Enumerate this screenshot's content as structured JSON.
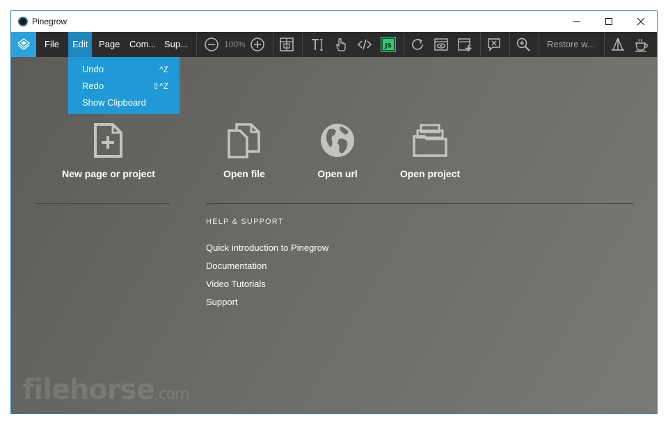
{
  "window": {
    "title": "Pinegrow",
    "controls": {
      "minimize": "minimize",
      "maximize": "maximize",
      "close": "close"
    }
  },
  "menubar": {
    "items": [
      "File",
      "Edit",
      "Page",
      "Com...",
      "Sup..."
    ],
    "active": "Edit"
  },
  "toolbar": {
    "zoom_level": "100%",
    "restore_label": "Restore w...",
    "icons": [
      "zoom-out-icon",
      "zoom-in-icon",
      "layout-frame-icon",
      "text-edit-icon",
      "hand-pointer-icon",
      "code-icon",
      "javascript-icon",
      "refresh-icon",
      "preview-eye-icon",
      "add-page-icon",
      "chat-icon",
      "search-zoom-icon",
      "tools-icon",
      "coffee-icon"
    ],
    "js_accent": "#2ecc71"
  },
  "edit_menu": {
    "items": [
      {
        "label": "Undo",
        "shortcut": "^Z"
      },
      {
        "label": "Redo",
        "shortcut": "⇧^Z"
      },
      {
        "label": "Show Clipboard",
        "shortcut": ""
      }
    ]
  },
  "actions": [
    {
      "label": "New page or project",
      "icon": "new-file-icon"
    },
    {
      "label": "Open file",
      "icon": "open-file-icon"
    },
    {
      "label": "Open url",
      "icon": "globe-icon"
    },
    {
      "label": "Open project",
      "icon": "folder-icon"
    }
  ],
  "help": {
    "heading": "HELP & SUPPORT",
    "links": [
      "Quick introduction to Pinegrow",
      "Documentation",
      "Video Tutorials",
      "Support"
    ]
  },
  "watermark": {
    "text": "filehorse",
    "suffix": ".com"
  },
  "colors": {
    "accent": "#1f9ad6",
    "toolbar_bg": "#2b2b2b",
    "content_bg": "#676662"
  }
}
